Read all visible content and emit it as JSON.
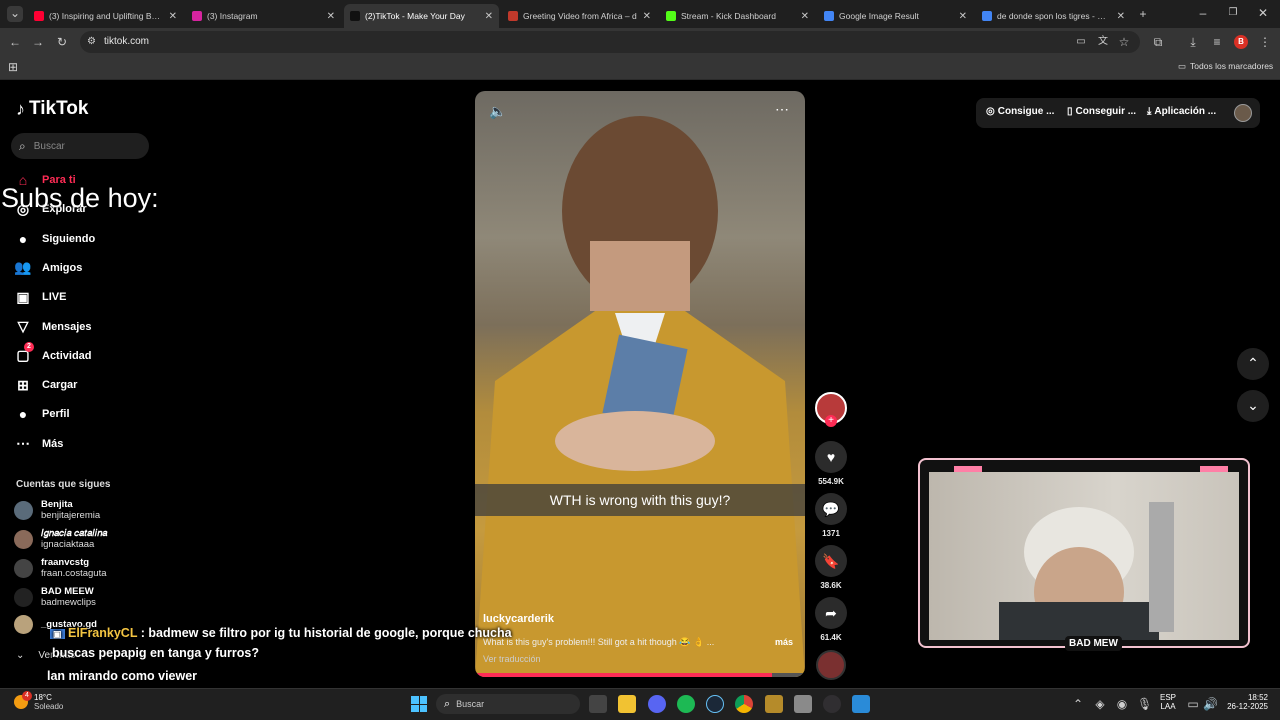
{
  "browser": {
    "tabs": [
      {
        "title": "(3) Inspiring and Uplifting Backg",
        "icon": "youtube-icon",
        "color": "#ff0033"
      },
      {
        "title": "(3) Instagram",
        "icon": "instagram-icon",
        "color": "#d6249f"
      },
      {
        "title": "(2)TikTok - Make Your Day",
        "icon": "tiktok-icon",
        "color": "#111111",
        "active": true
      },
      {
        "title": "Greeting Video from Africa – d",
        "icon": "page-icon",
        "color": "#c0392b"
      },
      {
        "title": "Stream - Kick Dashboard",
        "icon": "kick-icon",
        "color": "#53fc18"
      },
      {
        "title": "Google Image Result",
        "icon": "google-icon",
        "color": "#4285f4"
      },
      {
        "title": "de donde spon los tigres - Goo",
        "icon": "google-icon",
        "color": "#4285f4"
      }
    ],
    "url": "tiktok.com",
    "bookmarks_label": "Todos los marcadores",
    "profile_initial": "B"
  },
  "tiktok": {
    "logo": "TikTok",
    "search_placeholder": "Buscar",
    "nav": [
      {
        "label": "Para ti",
        "icon": "home-icon",
        "active": true
      },
      {
        "label": "Explorar",
        "icon": "compass-icon"
      },
      {
        "label": "Siguiendo",
        "icon": "following-avatar-icon"
      },
      {
        "label": "Amigos",
        "icon": "friends-icon"
      },
      {
        "label": "LIVE",
        "icon": "live-icon"
      },
      {
        "label": "Mensajes",
        "icon": "send-icon"
      },
      {
        "label": "Actividad",
        "icon": "activity-icon",
        "badge": "2"
      },
      {
        "label": "Cargar",
        "icon": "upload-icon"
      },
      {
        "label": "Perfil",
        "icon": "profile-icon"
      },
      {
        "label": "Más",
        "icon": "more-icon"
      }
    ],
    "following_header": "Cuentas que sigues",
    "following": [
      {
        "name": "Benjita",
        "handle": "benjitajeremia"
      },
      {
        "name": "𝐼𝑔𝑛𝑎𝑐𝑖𝑎 𝑐𝑎𝑡𝑎𝑙𝑖𝑛𝑎",
        "handle": "ignaciaktaaa"
      },
      {
        "name": "fraanvcstg",
        "handle": "fraan.costaguta"
      },
      {
        "name": "BAD MEEW",
        "handle": "badmewclips"
      },
      {
        "name": "_gustavo.gd",
        "handle": ""
      }
    ],
    "see_more": "Ver más",
    "top_buttons": [
      "Consigue ...",
      "Conseguir ...",
      "Aplicación ..."
    ],
    "video": {
      "caption_overlay": "WTH is wrong with this guy!?",
      "author": "luckycarderik",
      "description": "What is this guy's problem!!! Still got a hit though 😂 👌 ...",
      "more": "más",
      "translate": "Ver traducción",
      "likes": "554.9K",
      "comments": "1371",
      "saves": "38.6K",
      "shares": "61.4K"
    }
  },
  "overlay": {
    "subs_title": "Subs de hoy:",
    "chat_line_1_user": "ElFrankyCL",
    "chat_line_1_text": ": badmew se filtro por ig tu historial de google, porque chucha",
    "chat_line_2": "buscas pepapig en tanga y furros?",
    "chat_line_3": "lan mirando como viewer",
    "webcam_logo": "BAD MEW"
  },
  "taskbar": {
    "weather_temp": "18°C",
    "weather_desc": "Soleado",
    "weather_badge": "4",
    "search_placeholder": "Buscar",
    "lang_1": "ESP",
    "lang_2": "LAA",
    "time": "18:52",
    "date": "26-12-2025"
  }
}
